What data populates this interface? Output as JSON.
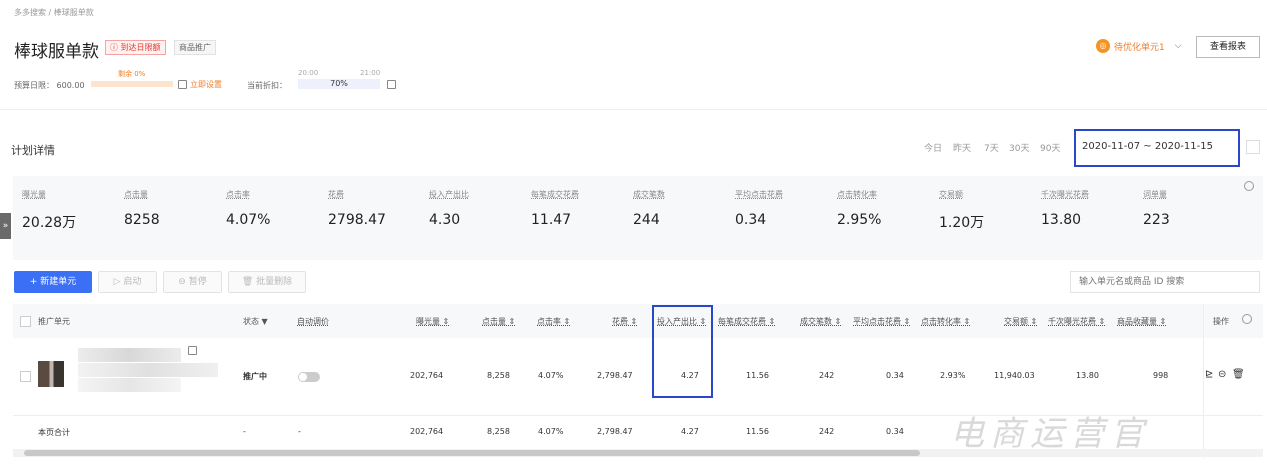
{
  "breadcrumb": "多多搜索 / 棒球服单款",
  "page": {
    "title": "棒球服单款",
    "badge_alert": "ⓘ 到达日限额",
    "badge_type": "商品推广"
  },
  "budget": {
    "label": "预算日限： 600.00",
    "remain": "剩余 0%",
    "set_now": "立即设置",
    "discount_label": "当前折扣：",
    "time_start": "20:00",
    "time_end": "21:00",
    "discount_value": "70%"
  },
  "header_right": {
    "optimize": "待优化单元1",
    "report_button": "查看报表"
  },
  "plan": {
    "title": "计划详情",
    "ranges": [
      "今日",
      "昨天",
      "7天",
      "30天",
      "90天"
    ],
    "date_range": "2020-11-07 ~ 2020-11-15"
  },
  "metrics": [
    {
      "label": "曝光量",
      "value": "20.28万"
    },
    {
      "label": "点击量",
      "value": "8258"
    },
    {
      "label": "点击率",
      "value": "4.07%"
    },
    {
      "label": "花费",
      "value": "2798.47"
    },
    {
      "label": "投入产出比",
      "value": "4.30"
    },
    {
      "label": "每笔成交花费",
      "value": "11.47"
    },
    {
      "label": "成交笔数",
      "value": "244"
    },
    {
      "label": "平均点击花费",
      "value": "0.34"
    },
    {
      "label": "点击转化率",
      "value": "2.95%"
    },
    {
      "label": "交易额",
      "value": "1.20万"
    },
    {
      "label": "千次曝光花费",
      "value": "13.80"
    },
    {
      "label": "词单量",
      "value": "223"
    }
  ],
  "toolbar": {
    "new": "+ 新建单元",
    "start": "启动",
    "pause": "暂停",
    "batch_delete": "批量删除",
    "search_placeholder": "输入单元名或商品 ID 搜索"
  },
  "table": {
    "headers": {
      "unit": "推广单元",
      "status": "状态 ▼",
      "auto": "自动调价",
      "impressions": "曝光量 ⇕",
      "clicks": "点击量 ⇕",
      "ctr": "点击率 ⇕",
      "cost": "花费 ⇕",
      "roi": "投入产出比 ⇕",
      "cost_per_order": "每笔成交花费 ⇕",
      "orders": "成交笔数 ⇕",
      "cpc": "平均点击花费 ⇕",
      "cvr": "点击转化率 ⇕",
      "gmv": "交易额 ⇕",
      "cpm": "千次曝光花费 ⇕",
      "favorites": "商品收藏量 ⇕",
      "ops": "操作"
    },
    "row": {
      "status": "推广中",
      "impressions": "202,764",
      "clicks": "8,258",
      "ctr": "4.07%",
      "cost": "2,798.47",
      "roi": "4.27",
      "cost_per_order": "11.56",
      "orders": "242",
      "cpc": "0.34",
      "cvr": "2.93%",
      "gmv": "11,940.03",
      "cpm": "13.80",
      "favorites": "998"
    },
    "total": {
      "label": "本页合计",
      "status": "-",
      "auto": "-",
      "impressions": "202,764",
      "clicks": "8,258",
      "ctr": "4.07%",
      "cost": "2,798.47",
      "roi": "4.27",
      "cost_per_order": "11.56",
      "orders": "242",
      "cpc": "0.34"
    }
  },
  "watermark": "电商运营官"
}
